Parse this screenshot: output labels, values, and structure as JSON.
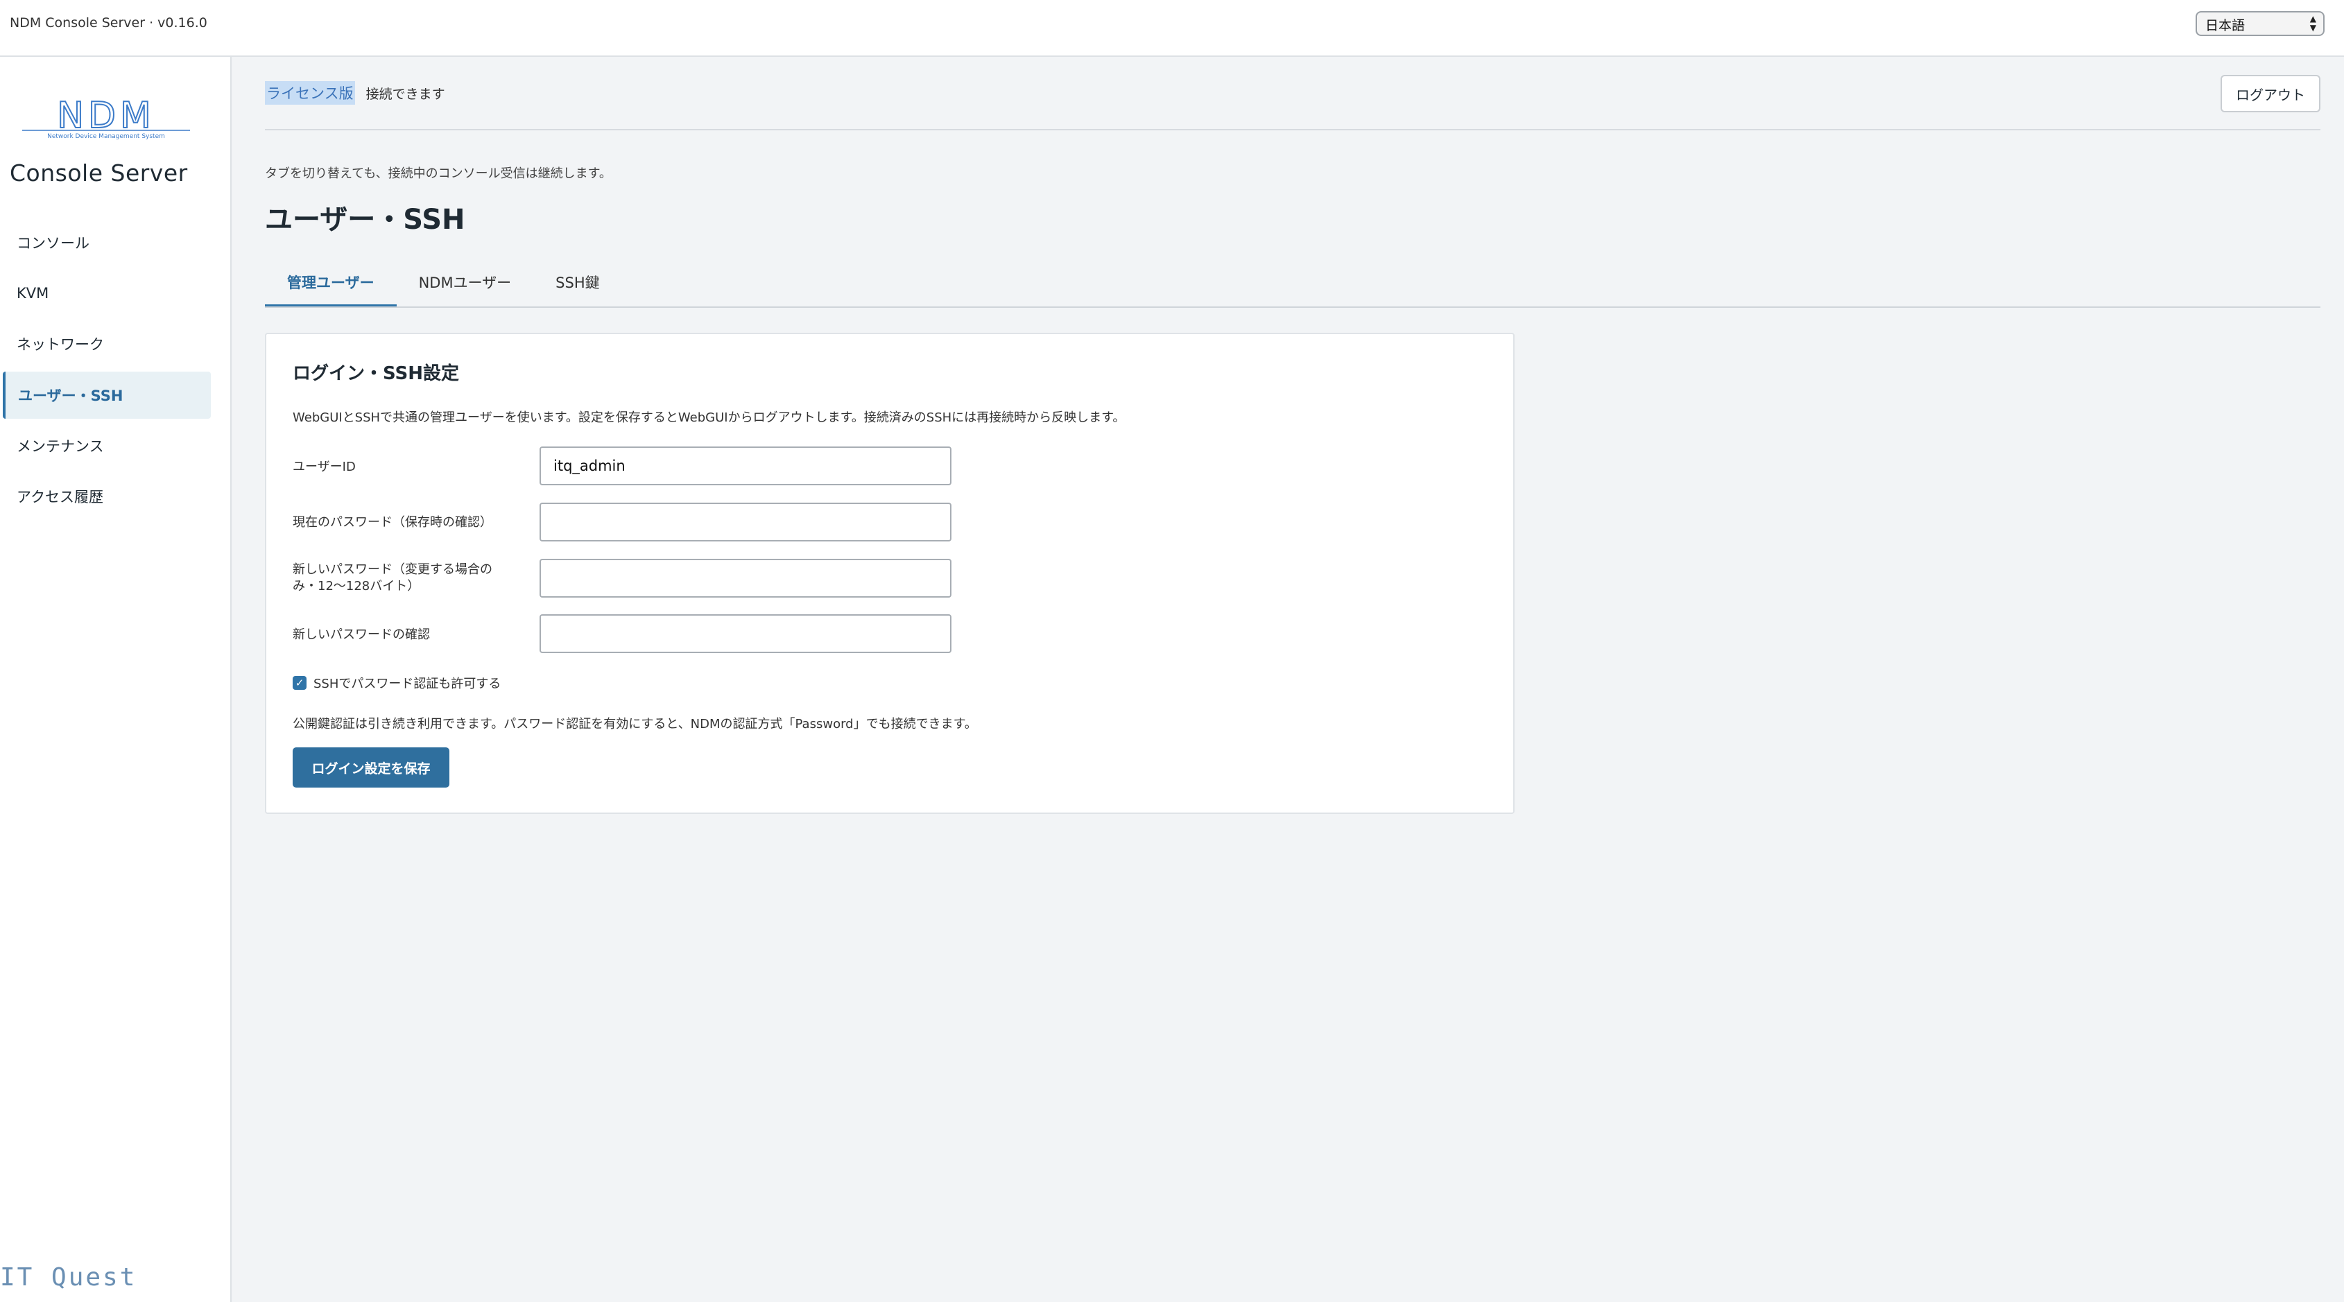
{
  "header": {
    "app_title": "NDM Console Server · v0.16.0",
    "language": "日本語"
  },
  "sidebar": {
    "logo_text": "NDM",
    "logo_subtitle": "Network Device Management System",
    "brand": "Console Server",
    "items": [
      {
        "label": "コンソール"
      },
      {
        "label": "KVM"
      },
      {
        "label": "ネットワーク"
      },
      {
        "label": "ユーザー・SSH"
      },
      {
        "label": "メンテナンス"
      },
      {
        "label": "アクセス履歴"
      }
    ],
    "footer": "IT Quest"
  },
  "status": {
    "license": "ライセンス版",
    "connection": "接続できます",
    "logout": "ログアウト"
  },
  "main": {
    "note": "タブを切り替えても、接続中のコンソール受信は継続します。",
    "title": "ユーザー・SSH",
    "tabs": [
      {
        "label": "管理ユーザー"
      },
      {
        "label": "NDMユーザー"
      },
      {
        "label": "SSH鍵"
      }
    ]
  },
  "card": {
    "title": "ログイン・SSH設定",
    "description": "WebGUIとSSHで共通の管理ユーザーを使います。設定を保存するとWebGUIからログアウトします。接続済みのSSHには再接続時から反映します。",
    "fields": {
      "user_id_label": "ユーザーID",
      "user_id_value": "itq_admin",
      "current_password_label": "現在のパスワード（保存時の確認）",
      "new_password_label": "新しいパスワード（変更する場合のみ・12〜128バイト）",
      "confirm_password_label": "新しいパスワードの確認"
    },
    "ssh_password_checkbox": "SSHでパスワード認証も許可する",
    "note": "公開鍵認証は引き続き利用できます。パスワード認証を有効にすると、NDMの認証方式「Password」でも接続できます。",
    "save_button": "ログイン設定を保存"
  },
  "colors": {
    "accent": "#2f74a8",
    "button": "#2f6f9e",
    "active_nav_bg": "#e8f1f5"
  }
}
